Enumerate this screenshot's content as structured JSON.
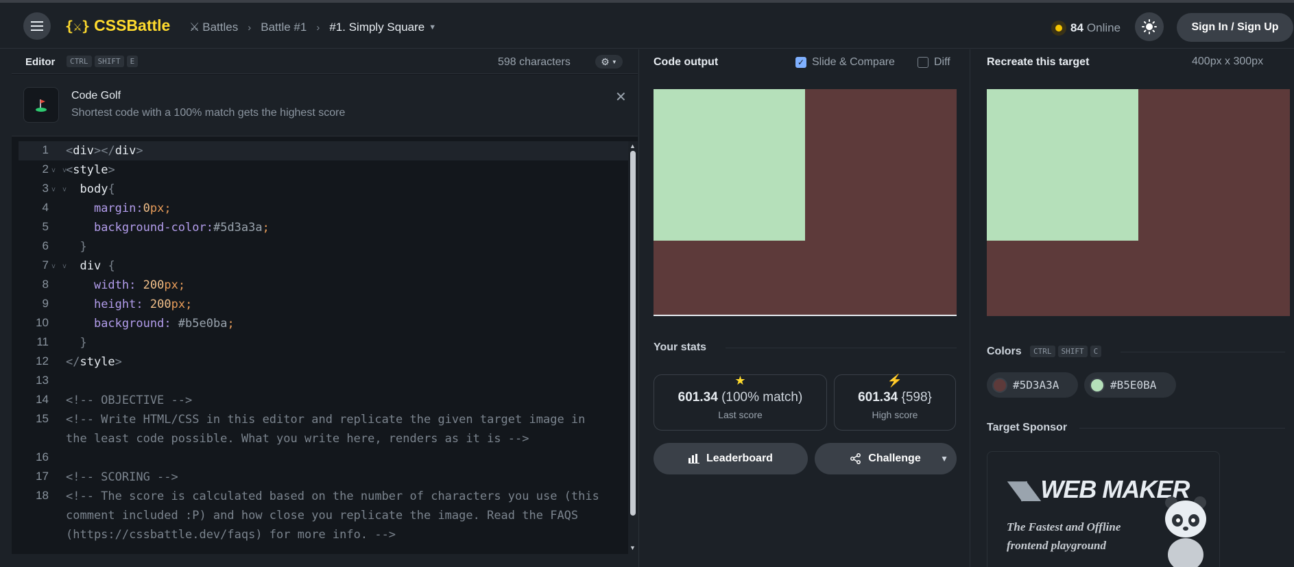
{
  "colors": {
    "accent": "#ffdb2e",
    "bg": "#1c2127",
    "editor_bg": "#13171c",
    "target_bg": "#5d3a3a",
    "target_fg": "#b5e0ba"
  },
  "header": {
    "menu_icon": "hamburger-icon",
    "logo": "CSSBattle",
    "breadcrumbs": [
      "Battles",
      "Battle #1",
      "#1. Simply Square"
    ],
    "online_count": "84",
    "online_label": "Online",
    "theme_icon": "sun-icon",
    "signin_label": "Sign In / Sign Up"
  },
  "editor": {
    "title": "Editor",
    "shortcut": [
      "CTRL",
      "SHIFT",
      "E"
    ],
    "char_count": "598 characters",
    "golf": {
      "title": "Code Golf",
      "description": "Shortest code with a 100% match gets the highest score"
    },
    "lines": [
      {
        "n": "1"
      },
      {
        "n": "2"
      },
      {
        "n": "3"
      },
      {
        "n": "4"
      },
      {
        "n": "5"
      },
      {
        "n": "6"
      },
      {
        "n": "7"
      },
      {
        "n": "8"
      },
      {
        "n": "9"
      },
      {
        "n": "10"
      },
      {
        "n": "11"
      },
      {
        "n": "12"
      },
      {
        "n": "13"
      },
      {
        "n": "14"
      },
      {
        "n": "15"
      },
      {
        "n": "16"
      },
      {
        "n": "17"
      },
      {
        "n": "18"
      }
    ],
    "code": {
      "l1_a": "<",
      "l1_b": "div",
      "l1_c": "></",
      "l1_d": "div",
      "l1_e": ">",
      "l2_a": "<",
      "l2_b": "style",
      "l2_c": ">",
      "l3_a": "body",
      "l3_b": "{",
      "l4_a": "margin",
      "l4_b": ":",
      "l4_c": "0",
      "l4_d": "px",
      "l4_e": ";",
      "l5_a": "background-color",
      "l5_b": ":",
      "l5_c": "#5d3a3a",
      "l5_d": ";",
      "l6_a": "}",
      "l7_a": "div",
      "l7_b": " {",
      "l8_a": "width",
      "l8_b": ": ",
      "l8_c": "200",
      "l8_d": "px",
      "l8_e": ";",
      "l9_a": "height",
      "l9_b": ": ",
      "l9_c": "200",
      "l9_d": "px",
      "l9_e": ";",
      "l10_a": "background",
      "l10_b": ": ",
      "l10_c": "#b5e0ba",
      "l10_d": ";",
      "l11_a": "}",
      "l12_a": "</",
      "l12_b": "style",
      "l12_c": ">",
      "l14": "<!-- OBJECTIVE -->",
      "l15a": "<!-- Write HTML/CSS in this editor and replicate the given target image in",
      "l15b": "the least code possible. What you write here, renders as it is -->",
      "l17": "<!-- SCORING -->",
      "l18a": "<!-- The score is calculated based on the number of characters you use (this",
      "l18b": "comment included :P) and how close you replicate the image. Read the FAQS",
      "l18c": "(https://cssbattle.dev/faqs) for more info. -->"
    }
  },
  "output": {
    "title": "Code output",
    "slide_compare": "Slide & Compare",
    "slide_compare_checked": true,
    "diff": "Diff",
    "diff_checked": false,
    "stats_title": "Your stats",
    "last_score": "601.34",
    "last_match": "(100% match)",
    "last_label": "Last score",
    "high_score": "601.34",
    "high_chars": "{598}",
    "high_label": "High score",
    "leaderboard": "Leaderboard",
    "challenge": "Challenge"
  },
  "target": {
    "title": "Recreate this target",
    "dimensions": "400px x 300px",
    "colors_title": "Colors",
    "colors_shortcut": [
      "CTRL",
      "SHIFT",
      "C"
    ],
    "swatches": [
      "#5D3A3A",
      "#B5E0BA"
    ],
    "sponsor_title": "Target Sponsor",
    "sponsor_logo": "WEB MAKER",
    "sponsor_tag1": "The Fastest and Offline",
    "sponsor_tag2": "frontend playground"
  }
}
